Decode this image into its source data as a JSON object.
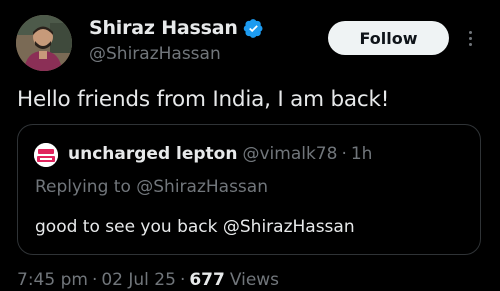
{
  "author": {
    "display_name": "Shiraz Hassan",
    "handle": "@ShirazHassan",
    "verified_icon": "verified-badge-icon",
    "verified_color": "#1d9bf0"
  },
  "actions": {
    "follow_label": "Follow",
    "more_icon": "more-vertical-icon"
  },
  "tweet": {
    "text": "Hello friends from India, I am back!"
  },
  "quoted": {
    "display_name": "uncharged lepton",
    "handle": "@vimalk78",
    "separator": "·",
    "time": "1h",
    "replying_prefix": "Replying to",
    "replying_handle": "@ShirazHassan",
    "text": "good to see you back @ShirazHassan"
  },
  "meta": {
    "time": "7:45 pm",
    "separator": "·",
    "date": "02 Jul 25",
    "views_count": "677",
    "views_label": "Views"
  },
  "colors": {
    "background": "#000000",
    "primary_text": "#e7e9ea",
    "secondary_text": "#71767b",
    "border": "#2f3336",
    "follow_bg": "#eff3f4"
  }
}
